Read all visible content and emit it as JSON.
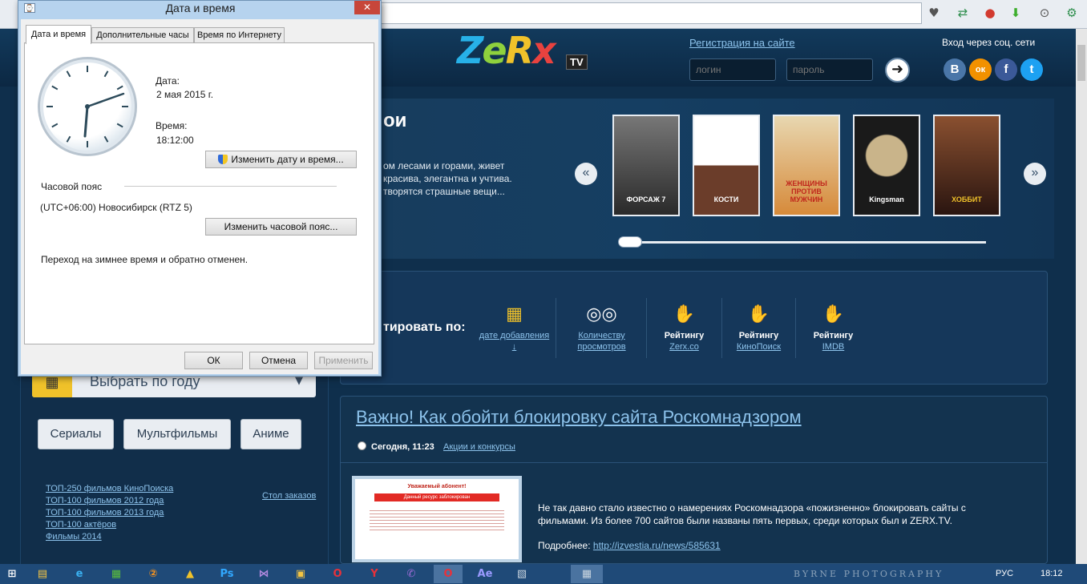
{
  "dialog": {
    "title": "Дата и время",
    "tabs": [
      "Дата и время",
      "Дополнительные часы",
      "Время по Интернету"
    ],
    "date_label": "Дата:",
    "date_value": "2 мая 2015 г.",
    "time_label": "Время:",
    "time_value": "18:12:00",
    "change_datetime_btn": "Изменить дату и время...",
    "timezone_label": "Часовой пояс",
    "timezone_value": "(UTC+06:00) Новосибирск (RTZ 5)",
    "change_timezone_btn": "Изменить часовой пояс...",
    "dst_note": "Переход на зимнее время и обратно отменен.",
    "ok": "ОК",
    "cancel": "Отмена",
    "apply": "Применить",
    "close": "✕"
  },
  "site": {
    "logo": {
      "z": "Z",
      "e": "e",
      "r": "R",
      "x": "x",
      "tv": "TV"
    },
    "register_link": "Регистрация на сайте",
    "login_placeholder": "логин",
    "password_placeholder": "пароль",
    "go": "➜",
    "social_title": "Вход через соц. сети",
    "social": [
      {
        "label": "В",
        "color": "#4a76a8"
      },
      {
        "label": "ок",
        "color": "#f29100"
      },
      {
        "label": "f",
        "color": "#3b5998"
      },
      {
        "label": "t",
        "color": "#1da1f2"
      }
    ],
    "slider_heading": "ои",
    "slider_desc": "ом лесами и горами, живет красива, элегантна и учтива. творятся страшные вещи...",
    "prev": "«",
    "next": "»",
    "posters": [
      {
        "title": "ФОРСАЖ 7",
        "color": "#3a3a3a"
      },
      {
        "title": "КОСТИ",
        "color": "#5a3a30"
      },
      {
        "title": "ЖЕНЩИНЫ ПРОТИВ МУЖЧИН",
        "color": "#d89a3a"
      },
      {
        "title": "Kingsman",
        "color": "#2b3b4a"
      },
      {
        "title": "ХОББИТ",
        "color": "#5a2e1e"
      }
    ],
    "sort_label": "тировать по:",
    "sort_items": [
      {
        "icon": "▦",
        "line1": "",
        "line2": "дате добавления ↓",
        "icon_name": "calendar-icon"
      },
      {
        "icon": "◎◎",
        "line1": "",
        "line2": "Количеству просмотров",
        "icon_name": "glasses-icon"
      },
      {
        "icon": "👍",
        "line1": "Рейтингу",
        "line2": "Zerx.co",
        "icon_name": "thumbs-up-icon"
      },
      {
        "icon": "👍",
        "line1": "Рейтингу",
        "line2": "КиноПоиск",
        "icon_name": "thumbs-up-icon"
      },
      {
        "icon": "👍",
        "line1": "Рейтингу",
        "line2": "IMDB",
        "icon_name": "thumbs-up-icon"
      }
    ],
    "year_select": "Выбрать по году",
    "year_caret": "▼",
    "genres": [
      "Сериалы",
      "Мультфильмы",
      "Аниме"
    ],
    "top_links": [
      "ТОП-250 фильмов КиноПоиска",
      "ТОП-100 фильмов 2012 года",
      "ТОП-100 фильмов 2013 года",
      "ТОП-100 актёров",
      "Фильмы 2014"
    ],
    "orders_link": "Стол заказов",
    "article": {
      "title": "Важно! Как обойти блокировку сайта Роскомнадзором",
      "date": "Сегодня, 11:23",
      "category": "Акции и конкурсы",
      "image_title": "Уважаемый абонент!",
      "image_banner": "Данный ресурс заблокирован",
      "text": "Не так давно стало известно о намерениях Роскомнадзора «пожизненно» блокировать сайты с фильмами. Из более 700 сайтов были названы пять первых, среди которых был и ZERX.TV.",
      "more_label": "Подробнее:",
      "more_link": "http://izvestia.ru/news/585631"
    }
  },
  "taskbar": {
    "lang": "РУС",
    "time": "18:12",
    "watermark": "BYRNE PHOTOGRAPHY"
  }
}
